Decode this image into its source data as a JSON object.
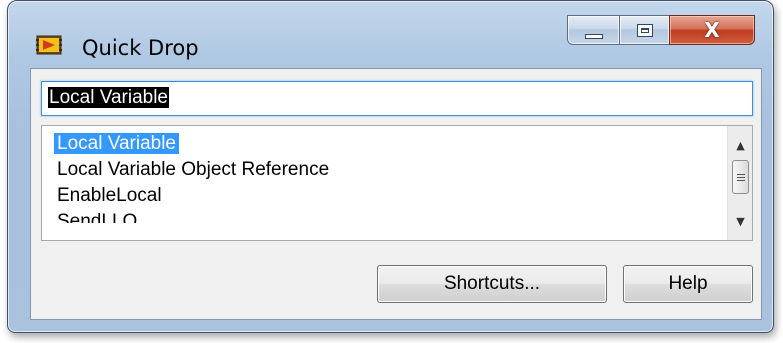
{
  "window": {
    "title": "Quick Drop",
    "icon": "labview-quick-drop-icon",
    "minimize_icon": "minimize-icon",
    "maximize_icon": "maximize-icon",
    "close_icon": "close-icon",
    "close_glyph": "X"
  },
  "search": {
    "value": "Local Variable"
  },
  "results": {
    "items": [
      {
        "label": "Local Variable",
        "selected": true
      },
      {
        "label": "Local Variable Object Reference",
        "selected": false
      },
      {
        "label": "EnableLocal",
        "selected": false
      },
      {
        "label": "SendLLO",
        "selected": false
      }
    ]
  },
  "scrollbar": {
    "up_glyph": "▲",
    "down_glyph": "▼"
  },
  "buttons": {
    "shortcuts_label": "Shortcuts...",
    "help_label": "Help"
  },
  "colors": {
    "selection": "#3399ff",
    "close_button": "#c13b20",
    "frame": "#a9c2dd"
  }
}
